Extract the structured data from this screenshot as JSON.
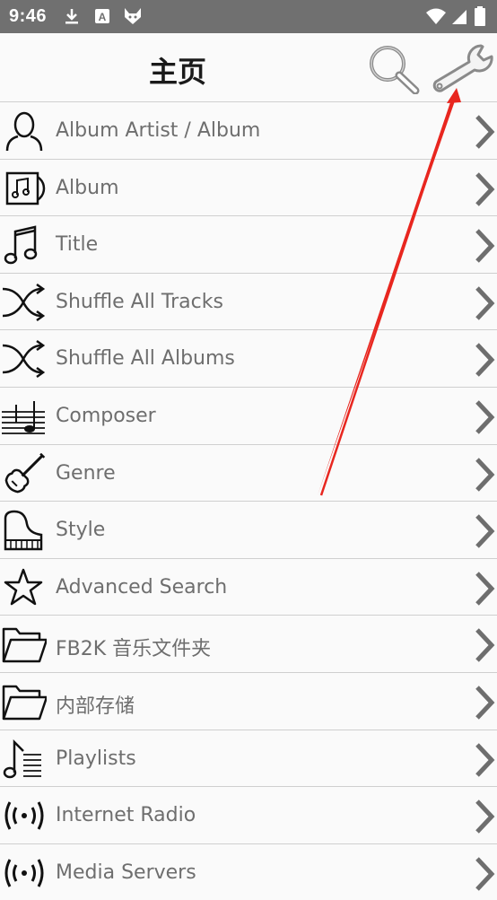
{
  "status_bar": {
    "time": "9:46",
    "icons": [
      "download-icon",
      "a-badge-icon",
      "fox-icon",
      "wifi-icon",
      "signal-icon",
      "battery-icon"
    ]
  },
  "header": {
    "title": "主页",
    "buttons": [
      "search-icon",
      "wrench-icon"
    ]
  },
  "menu": {
    "items": [
      {
        "label": "Album Artist / Album",
        "icon": "person-icon"
      },
      {
        "label": "Album",
        "icon": "album-icon"
      },
      {
        "label": "Title",
        "icon": "music-note-icon"
      },
      {
        "label": "Shuffle All Tracks",
        "icon": "shuffle-icon"
      },
      {
        "label": "Shuffle All Albums",
        "icon": "shuffle-icon"
      },
      {
        "label": "Composer",
        "icon": "staff-icon"
      },
      {
        "label": "Genre",
        "icon": "violin-icon"
      },
      {
        "label": "Style",
        "icon": "piano-icon"
      },
      {
        "label": "Advanced Search",
        "icon": "star-icon"
      },
      {
        "label": "FB2K 音乐文件夹",
        "icon": "folder-icon"
      },
      {
        "label": "内部存储",
        "icon": "folder-icon"
      },
      {
        "label": "Playlists",
        "icon": "playlist-icon"
      },
      {
        "label": "Internet Radio",
        "icon": "radio-icon"
      },
      {
        "label": "Media Servers",
        "icon": "radio-icon"
      }
    ]
  },
  "colors": {
    "status_bar": "#707070",
    "background": "#fafafa",
    "label_text": "#6e6e6e",
    "annotation_arrow": "#e8261f"
  }
}
